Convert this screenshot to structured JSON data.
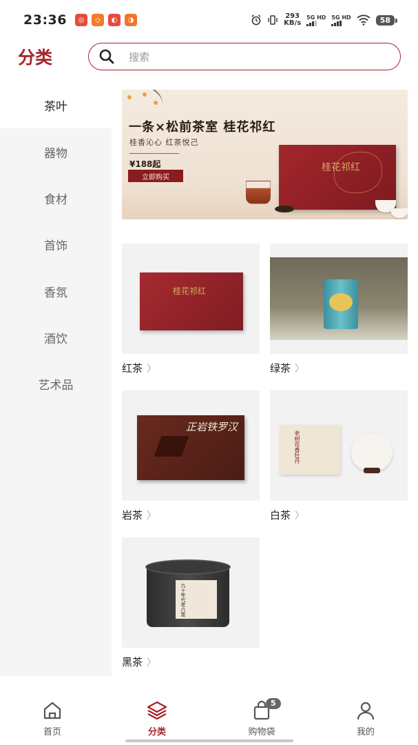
{
  "status_bar": {
    "time": "23:36",
    "net_speed_value": "293",
    "net_speed_unit": "KB/s",
    "sig1": "5G HD",
    "sig2": "5G HD",
    "battery": "58"
  },
  "header": {
    "title": "分类",
    "search_placeholder": "搜索",
    "accent_color": "#a8222a"
  },
  "sidebar": {
    "items": [
      {
        "label": "茶叶",
        "active": true
      },
      {
        "label": "器物",
        "active": false
      },
      {
        "label": "食材",
        "active": false
      },
      {
        "label": "首饰",
        "active": false
      },
      {
        "label": "香氛",
        "active": false
      },
      {
        "label": "酒饮",
        "active": false
      },
      {
        "label": "艺术品",
        "active": false
      }
    ]
  },
  "banner": {
    "title": "一条×松前茶室 桂花祁红",
    "subtitle": "桂香沁心 红茶悦己",
    "price": "¥188起",
    "button": "立即购买",
    "box_text": "桂花祁红"
  },
  "categories": [
    {
      "label": "红茶",
      "box_text": "桂花祁红"
    },
    {
      "label": "绿茶"
    },
    {
      "label": "岩茶",
      "box_text": "正岩铁罗汉"
    },
    {
      "label": "白茶",
      "box_text": "老树花香牡丹"
    },
    {
      "label": "黑茶",
      "box_text": "九十年代老六堡"
    }
  ],
  "bottom_nav": {
    "items": [
      {
        "label": "首页",
        "icon": "home-icon",
        "active": false
      },
      {
        "label": "分类",
        "icon": "layers-icon",
        "active": true
      },
      {
        "label": "购物袋",
        "icon": "bag-icon",
        "active": false,
        "badge": "5"
      },
      {
        "label": "我的",
        "icon": "person-icon",
        "active": false
      }
    ]
  }
}
